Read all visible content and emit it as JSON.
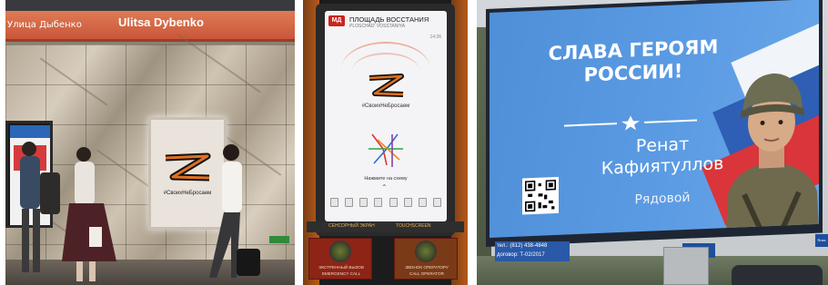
{
  "panel_metro": {
    "sign_ru": "Улица Дыбенко",
    "sign_en": "Ulitsa Dybenko",
    "poster_hashtag": "#СвоихНеБросаем"
  },
  "panel_kiosk": {
    "logo": "МД",
    "station_title": "ПЛОЩАДЬ ВОССТАНИЯ",
    "station_subtitle": "PLOSCHAD' VOSSTANIYA",
    "time": "14:36",
    "hashtag": "#СвоихНеБросаем",
    "tap_map": "Нажмите на схему",
    "touchscreen_ru": "СЕНСОРНЫЙ ЭКРАН",
    "touchscreen_en": "TOUCHSCREEN",
    "button_emergency_ru": "ЭКСТРЕННЫЙ ВЫЗОВ",
    "button_emergency_en": "EMERGENCY CALL",
    "button_operator_ru": "ЗВОНОК ОПЕРАТОРУ",
    "button_operator_en": "CALL OPERATOR"
  },
  "panel_billboard": {
    "headline_line1": "СЛАВА ГЕРОЯМ",
    "headline_line2": "РОССИИ!",
    "name_line1": "Ренат",
    "name_line2": "Кафиятуллов",
    "rank": "Рядовой",
    "phone": "тел.: (812) 438-4848",
    "contract": "договор: Т-02/2017",
    "brand": "Russ",
    "brand_small": "Russ"
  },
  "colors": {
    "metro_sign": "#d0603f",
    "billboard_blue": "#5b9be3",
    "kiosk_frame": "#b65a1c",
    "z_orange": "#e0701f",
    "z_black": "#111111"
  }
}
